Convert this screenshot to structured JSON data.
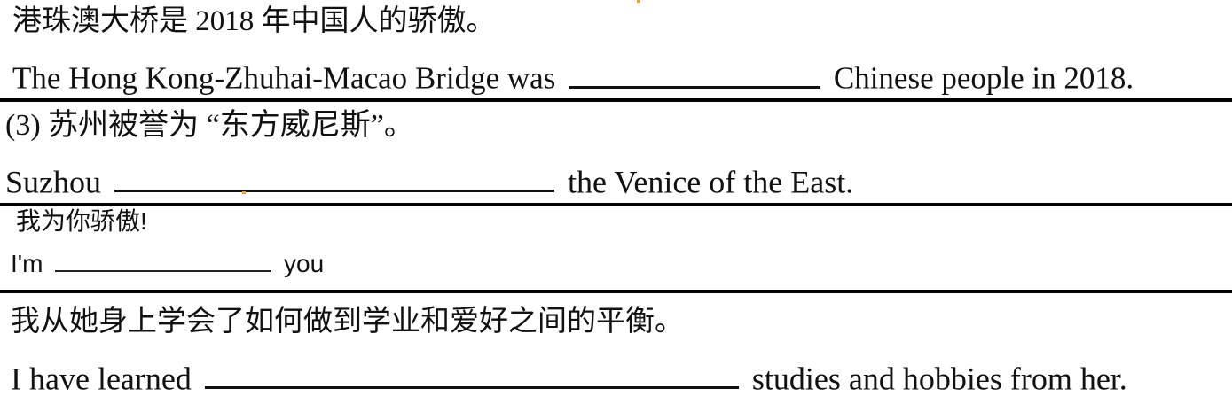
{
  "sections": [
    {
      "chinese": "港珠澳大桥是 2018 年中国人的骄傲。",
      "english_before": "The Hong Kong-Zhuhai-Macao Bridge was",
      "english_after": "Chinese people in 2018."
    },
    {
      "chinese": "(3) 苏州被誉为 “东方威尼斯”。",
      "english_before": "Suzhou",
      "english_after": "the Venice of the East."
    },
    {
      "chinese": "我为你骄傲!",
      "english_before": "I'm",
      "english_after": "you"
    },
    {
      "chinese": "我从她身上学会了如何做到学业和爱好之间的平衡。",
      "english_before": "I have learned",
      "english_after": "studies and hobbies from her."
    }
  ],
  "colors": {
    "text": "#111111",
    "divider": "#000000",
    "accent_dot": "#f0a030"
  }
}
